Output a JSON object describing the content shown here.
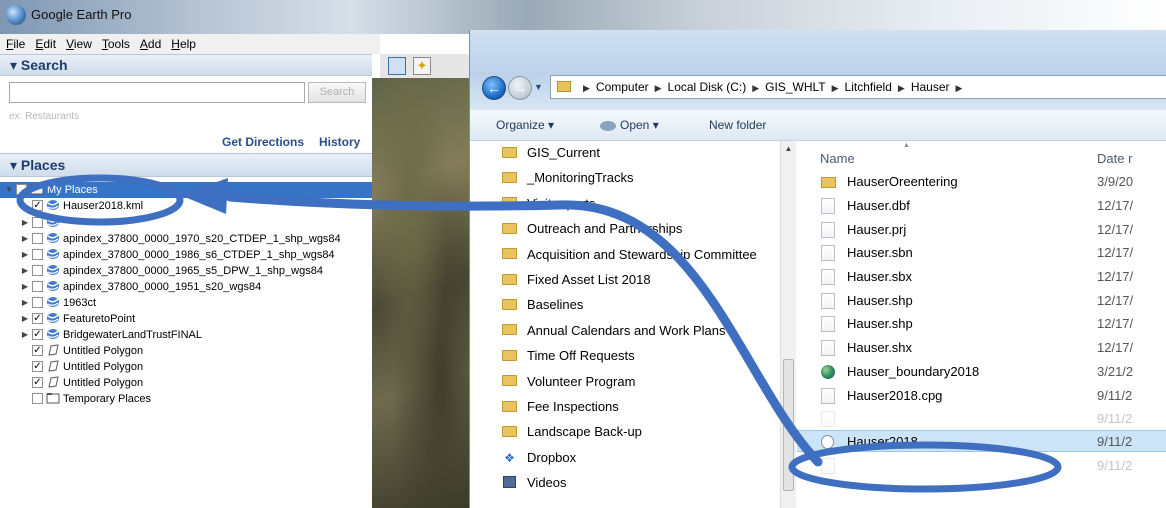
{
  "google_earth": {
    "title": "Google Earth Pro",
    "menu": [
      {
        "mn": "F",
        "rest": "ile"
      },
      {
        "mn": "E",
        "rest": "dit"
      },
      {
        "mn": "V",
        "rest": "iew"
      },
      {
        "mn": "T",
        "rest": "ools"
      },
      {
        "mn": "A",
        "rest": "dd"
      },
      {
        "mn": "H",
        "rest": "elp"
      }
    ],
    "search": {
      "header": "▾ Search",
      "input_value": "",
      "button_label": "Search",
      "hint": "ex: Restaurants",
      "get_directions": "Get Directions",
      "history": "History"
    },
    "places": {
      "header": "▾ Places",
      "tree": [
        {
          "label": "My Places",
          "level": 0,
          "twisty": "▼",
          "checked": "",
          "icon": "folder",
          "selected": true
        },
        {
          "label": "Hauser2018.kml",
          "level": 1,
          "twisty": "▶",
          "checked": "✓",
          "icon": "kml"
        },
        {
          "label": "",
          "level": 1,
          "twisty": "▶",
          "checked": "",
          "icon": "kml",
          "obscured": true
        },
        {
          "label": "apindex_37800_0000_1970_s20_CTDEP_1_shp_wgs84",
          "level": 1,
          "twisty": "▶",
          "checked": "",
          "icon": "kml"
        },
        {
          "label": "apindex_37800_0000_1986_s6_CTDEP_1_shp_wgs84",
          "level": 1,
          "twisty": "▶",
          "checked": "",
          "icon": "kml"
        },
        {
          "label": "apindex_37800_0000_1965_s5_DPW_1_shp_wgs84",
          "level": 1,
          "twisty": "▶",
          "checked": "",
          "icon": "kml"
        },
        {
          "label": "apindex_37800_0000_1951_s20_wgs84",
          "level": 1,
          "twisty": "▶",
          "checked": "",
          "icon": "kml"
        },
        {
          "label": "1963ct",
          "level": 1,
          "twisty": "▶",
          "checked": "",
          "icon": "kml"
        },
        {
          "label": "FeaturetoPoint",
          "level": 1,
          "twisty": "▶",
          "checked": "✓",
          "icon": "kml"
        },
        {
          "label": "BridgewaterLandTrustFINAL",
          "level": 1,
          "twisty": "▶",
          "checked": "✓",
          "icon": "kml"
        },
        {
          "label": "Untitled Polygon",
          "level": 1,
          "twisty": "",
          "checked": "✓",
          "icon": "polygon"
        },
        {
          "label": "Untitled Polygon",
          "level": 1,
          "twisty": "",
          "checked": "✓",
          "icon": "polygon"
        },
        {
          "label": "Untitled Polygon",
          "level": 1,
          "twisty": "",
          "checked": "✓",
          "icon": "polygon"
        },
        {
          "label": "Temporary Places",
          "level": 0,
          "twisty": "",
          "checked": "",
          "icon": "folder"
        }
      ]
    }
  },
  "explorer": {
    "nav_back": "←",
    "nav_forward": "→",
    "breadcrumb": [
      "Computer",
      "Local Disk (C:)",
      "GIS_WHLT",
      "Litchfield",
      "Hauser"
    ],
    "toolbar": {
      "organize": "Organize ▾",
      "open": "Open ▾",
      "new_folder": "New folder"
    },
    "nav_items": [
      {
        "label": "GIS_Current",
        "icon": "folder"
      },
      {
        "label": "_MonitoringTracks",
        "icon": "folder"
      },
      {
        "label": "Visit reports",
        "icon": "folder"
      },
      {
        "label": "Outreach and Partnerships",
        "icon": "folder"
      },
      {
        "label": "Acquisition and Stewardship Committee",
        "icon": "folder"
      },
      {
        "label": "Fixed Asset List 2018",
        "icon": "folder"
      },
      {
        "label": "Baselines",
        "icon": "folder"
      },
      {
        "label": "Annual Calendars and Work Plans",
        "icon": "folder"
      },
      {
        "label": "Time Off Requests",
        "icon": "folder"
      },
      {
        "label": "Volunteer Program",
        "icon": "folder"
      },
      {
        "label": "Fee Inspections",
        "icon": "folder"
      },
      {
        "label": "Landscape Back-up",
        "icon": "folder"
      },
      {
        "label": "Dropbox",
        "icon": "dropbox"
      },
      {
        "label": "Videos",
        "icon": "videos"
      }
    ],
    "columns": {
      "name": "Name",
      "date": "Date r"
    },
    "files": [
      {
        "name": "HauserOreentering",
        "date": "3/9/20",
        "icon": "folder"
      },
      {
        "name": "Hauser.dbf",
        "date": "12/17/",
        "icon": "doc"
      },
      {
        "name": "Hauser.prj",
        "date": "12/17/",
        "icon": "doc"
      },
      {
        "name": "Hauser.sbn",
        "date": "12/17/",
        "icon": "doc"
      },
      {
        "name": "Hauser.sbx",
        "date": "12/17/",
        "icon": "doc"
      },
      {
        "name": "Hauser.shp",
        "date": "12/17/",
        "icon": "doc"
      },
      {
        "name": "Hauser.shp",
        "date": "12/17/",
        "icon": "doc"
      },
      {
        "name": "Hauser.shx",
        "date": "12/17/",
        "icon": "doc"
      },
      {
        "name": "Hauser_boundary2018",
        "date": "3/21/2",
        "icon": "globe"
      },
      {
        "name": "Hauser2018.cpg",
        "date": "9/11/2",
        "icon": "doc"
      },
      {
        "name": "",
        "date": "9/11/2",
        "icon": "doc",
        "obscured": true
      },
      {
        "name": "Hauser2018",
        "date": "9/11/2",
        "icon": "kml",
        "selected": true
      },
      {
        "name": "",
        "date": "9/11/2",
        "icon": "doc",
        "obscured": true
      }
    ]
  },
  "colors": {
    "annotation": "#3f6fc1",
    "selection_blue": "#3574c6",
    "explorer_selection": "#cce4f7"
  }
}
